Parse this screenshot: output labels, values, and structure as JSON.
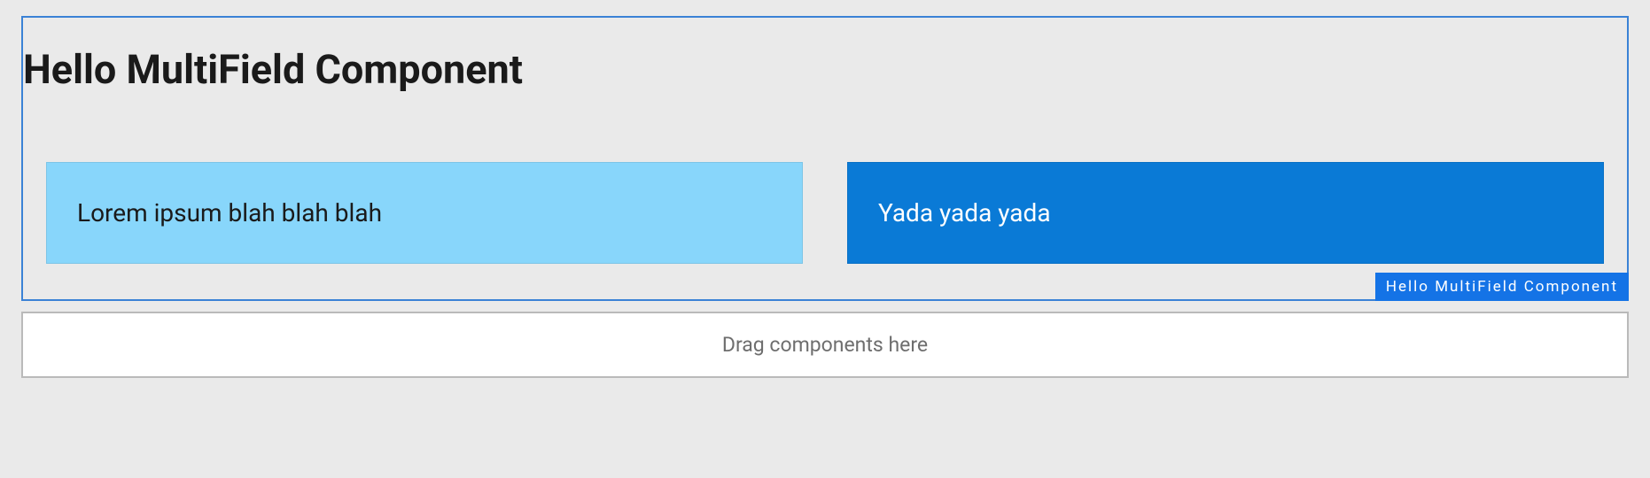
{
  "component": {
    "title": "Hello MultiField Component",
    "badge": "Hello MultiField Component",
    "cards": [
      {
        "text": "Lorem ipsum blah blah blah",
        "variant": "light"
      },
      {
        "text": "Yada yada yada",
        "variant": "dark"
      }
    ]
  },
  "dropzone": {
    "placeholder": "Drag components here"
  }
}
